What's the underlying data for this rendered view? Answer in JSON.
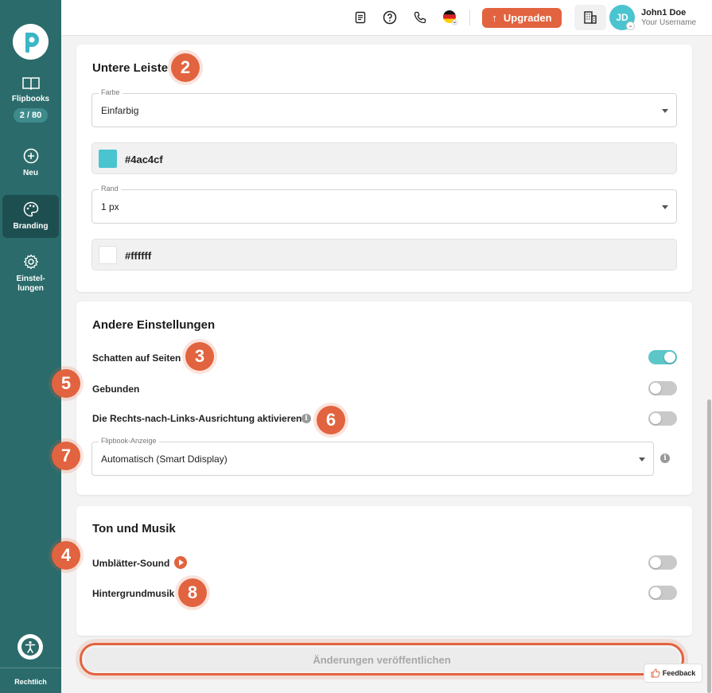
{
  "sidebar": {
    "items": [
      {
        "label": "Flipbooks",
        "icon": "book-open-icon",
        "badge": "2 / 80"
      },
      {
        "label": "Neu",
        "icon": "plus-circle-icon"
      },
      {
        "label": "Branding",
        "icon": "palette-icon"
      },
      {
        "label": "Einstel-\nlungen",
        "icon": "gear-icon"
      }
    ],
    "footer_label": "Rechtlich"
  },
  "topbar": {
    "upgrade_label": "Upgraden",
    "user_initials": "JD",
    "user_name": "John1 Doe",
    "user_sub": "Your Username"
  },
  "bottom_bar_section": {
    "title": "Untere Leiste",
    "color_field": {
      "label": "Farbe",
      "value": "Einfarbig"
    },
    "color_hex": "#4ac4cf",
    "border_field": {
      "label": "Rand",
      "value": "1 px"
    },
    "border_hex": "#ffffff"
  },
  "other_settings": {
    "title": "Andere Einstellungen",
    "shadow_label": "Schatten auf Seiten",
    "shadow_on": true,
    "bound_label": "Gebunden",
    "bound_on": false,
    "rtl_label": "Die Rechts-nach-Links-Ausrichtung aktivieren",
    "rtl_on": false,
    "display_field": {
      "label": "Flipbook-Anzeige",
      "value": "Automatisch (Smart Ddisplay)"
    }
  },
  "sound_section": {
    "title": "Ton und Musik",
    "page_sound_label": "Umblätter-Sound",
    "page_sound_on": false,
    "music_label": "Hintergrundmusik",
    "music_on": false
  },
  "publish_label": "Änderungen veröffentlichen",
  "feedback_label": "Feedback",
  "steps": [
    "2",
    "3",
    "5",
    "6",
    "7",
    "4",
    "8"
  ],
  "colors": {
    "accent": "#e2633f",
    "sidebar": "#2b6b6b",
    "toggle_on": "#5cc6c9"
  }
}
